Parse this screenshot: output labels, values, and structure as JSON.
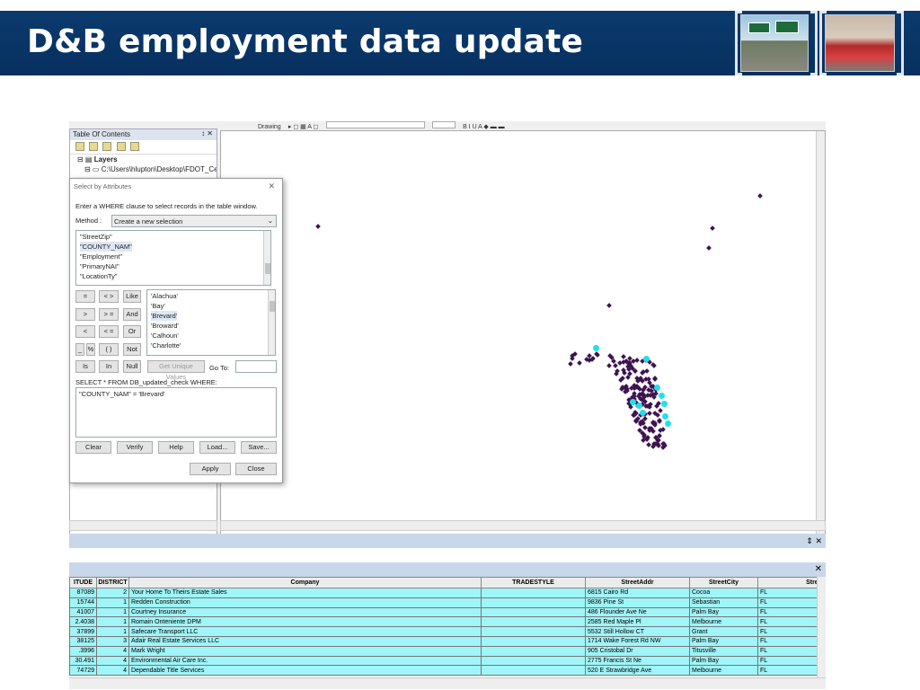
{
  "slide": {
    "title": "D&B employment data update"
  },
  "toolbar": {
    "drawing_label": "Drawing"
  },
  "toc": {
    "title": "Table Of Contents",
    "pin": "↕ ✕",
    "layers_label": "Layers",
    "path_label": "C:\\Users\\hlupton\\Desktop\\FDOT_Ce"
  },
  "dialog": {
    "title": "Select by Attributes",
    "instruction": "Enter a WHERE clause to select records in the table window.",
    "method_label": "Method :",
    "method_value": "Create a new selection",
    "fields": [
      "\"StreetZip\"",
      "\"COUNTY_NAM\"",
      "\"Employment\"",
      "\"PrimaryNAI\"",
      "\"LocationTy\""
    ],
    "operators": {
      "eq": "=",
      "ne": "< >",
      "like": "Like",
      "gt": ">",
      "ge": "> =",
      "and": "And",
      "lt": "<",
      "le": "< =",
      "or": "Or",
      "us": "_",
      "pct": "%",
      "paren": "( )",
      "not": "Not",
      "is": "Is",
      "in": "In",
      "null": "Null"
    },
    "values": [
      "'Alachua'",
      "'Bay'",
      "'Brevard'",
      "'Broward'",
      "'Calhoun'",
      "'Charlotte'"
    ],
    "get_unique_values": "Get Unique Values",
    "goto_label": "Go To:",
    "select_from": "SELECT * FROM DB_updated_check WHERE:",
    "where_clause": "\"COUNTY_NAM\" = 'Brevard'",
    "buttons": {
      "clear": "Clear",
      "verify": "Verify",
      "help": "Help",
      "load": "Load...",
      "save": "Save...",
      "apply": "Apply",
      "close": "Close"
    }
  },
  "table": {
    "columns": [
      "ITUDE",
      "DISTRICT",
      "Company",
      "TRADESTYLE",
      "StreetAddr",
      "StreetCity",
      "StreetSt"
    ],
    "rows": [
      [
        "87089",
        "2",
        "Your Home To Theirs Estate Sales",
        "",
        "6815 Cairo Rd",
        "Cocoa",
        "FL"
      ],
      [
        "15744",
        "1",
        "Redden Construction",
        "",
        "9836 Pine St",
        "Sebastian",
        "FL"
      ],
      [
        "41007",
        "1",
        "Courtney Insurance",
        "",
        "486 Flounder Ave Ne",
        "Palm Bay",
        "FL"
      ],
      [
        "2.4038",
        "1",
        "Romain Onteniente DPM",
        "",
        "2585 Red Maple Pl",
        "Melbourne",
        "FL"
      ],
      [
        "37899",
        "1",
        "Safecare Transport LLC",
        "",
        "5532 Still Hollow CT",
        "Grant",
        "FL"
      ],
      [
        "38125",
        "3",
        "Adair Real Estate Services LLC",
        "",
        "1714 Wake Forest Rd NW",
        "Palm Bay",
        "FL"
      ],
      [
        ".3996",
        "4",
        "Mark Wright",
        "",
        "905 Cristobal Dr",
        "Titusville",
        "FL"
      ],
      [
        "30.491",
        "4",
        "Environmental Air Care Inc.",
        "",
        "2775 Francis St Ne",
        "Palm Bay",
        "FL"
      ],
      [
        "74729",
        "4",
        "Dependable Title Services",
        "",
        "520 E Strawbridge Ave",
        "Melbourne",
        "FL"
      ]
    ]
  },
  "colors": {
    "banner": "#06305f",
    "point": "#3d1450",
    "selected_point": "#21e0ee",
    "selected_row": "#9ff5f8"
  }
}
